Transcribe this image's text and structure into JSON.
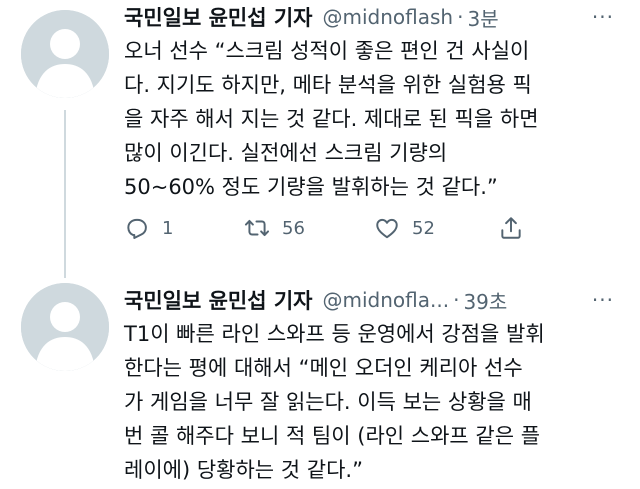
{
  "tweets": [
    {
      "author": "국민일보 윤민섭 기자",
      "handle": "@midnoflash",
      "separator": "·",
      "time": "3분",
      "more": "···",
      "text": "오너 선수 “스크림 성적이 좋은 편인 건 사실이\n다. 지기도 하지만, 메타 분석을 위한 실험용 픽\n을 자주 해서 지는 것 같다. 제대로 된 픽을 하면\n많이 이긴다. 실전에선 스크림 기량의\n50~60% 정도 기량을 발휘하는 것 같다.”",
      "actions": {
        "replies": "1",
        "retweets": "56",
        "likes": "52"
      }
    },
    {
      "author": "국민일보 윤민섭 기자",
      "handle": "@midnofla...",
      "separator": "·",
      "time": "39초",
      "more": "···",
      "text": "T1이 빠른 라인 스와프 등 운영에서 강점을 발휘\n한다는 평에 대해서 “메인 오더인 케리아 선수\n가 게임을 너무 잘 읽는다. 이득 보는 상황을 매\n번 콜 해주다 보니 적 팀이 (라인 스와프 같은 플\n레이에) 당황하는 것 같다.”"
    }
  ],
  "icons": {
    "reply": "reply-icon",
    "retweet": "retweet-icon",
    "like": "heart-icon",
    "share": "share-icon",
    "avatar": "default-avatar-icon"
  },
  "colors": {
    "secondary_text": "#536471",
    "avatar_bg": "#cfd9de",
    "thread_line": "#cfd9de"
  }
}
